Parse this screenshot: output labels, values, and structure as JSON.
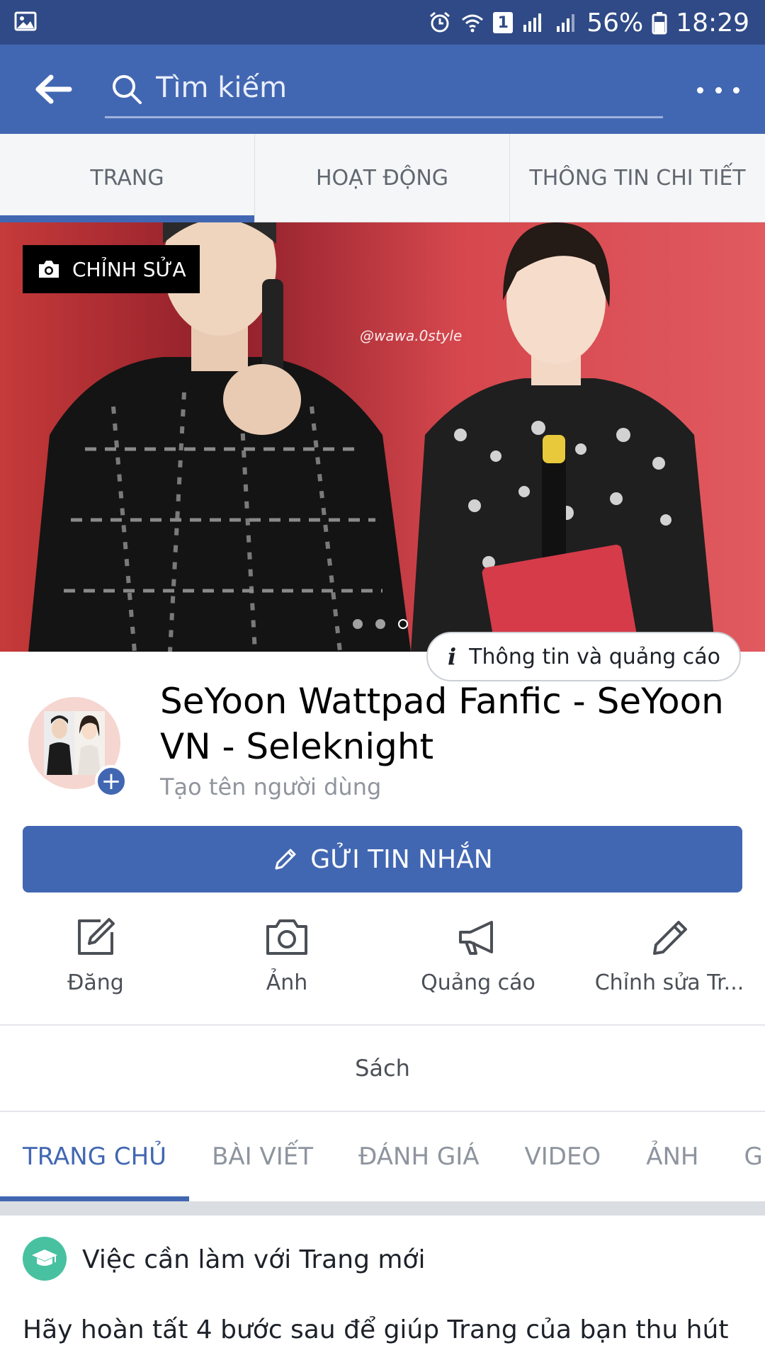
{
  "status_bar": {
    "battery": "56%",
    "time": "18:29",
    "sim_badge": "1",
    "icons": [
      "image-icon",
      "alarm-icon",
      "wifi-icon",
      "signal-icon",
      "battery-icon"
    ]
  },
  "header": {
    "search_placeholder": "Tìm kiếm"
  },
  "top_tabs": [
    {
      "label": "TRANG",
      "active": true
    },
    {
      "label": "HOẠT ĐỘNG",
      "active": false
    },
    {
      "label": "THÔNG TIN CHI TIẾT",
      "active": false
    }
  ],
  "cover": {
    "edit_label": "CHỈNH SỬA",
    "watermark": "@wawa.0style",
    "info_ads_label": "Thông tin và quảng cáo"
  },
  "page": {
    "title": "SeYoon Wattpad Fanfic - SeYoon VN - Seleknight",
    "username_prompt": "Tạo tên người dùng",
    "send_message_label": "GỬI TIN NHẮN"
  },
  "actions": [
    {
      "label": "Đăng",
      "icon": "compose-icon"
    },
    {
      "label": "Ảnh",
      "icon": "camera-icon"
    },
    {
      "label": "Quảng cáo",
      "icon": "megaphone-icon"
    },
    {
      "label": "Chỉnh sửa Tr...",
      "icon": "pencil-icon"
    }
  ],
  "category": "Sách",
  "bottom_tabs": [
    {
      "label": "TRANG CHỦ",
      "active": true
    },
    {
      "label": "BÀI VIẾT",
      "active": false
    },
    {
      "label": "ĐÁNH GIÁ",
      "active": false
    },
    {
      "label": "VIDEO",
      "active": false
    },
    {
      "label": "ẢNH",
      "active": false
    },
    {
      "label": "G",
      "active": false
    }
  ],
  "todo": {
    "title": "Việc cần làm với Trang mới",
    "text": "Hãy hoàn tất 4 bước sau để giúp Trang của bạn thu hút"
  },
  "colors": {
    "status_bar": "#2f4a86",
    "header": "#4267b2",
    "accent": "#4267b2",
    "todo_icon": "#48c1a0"
  }
}
